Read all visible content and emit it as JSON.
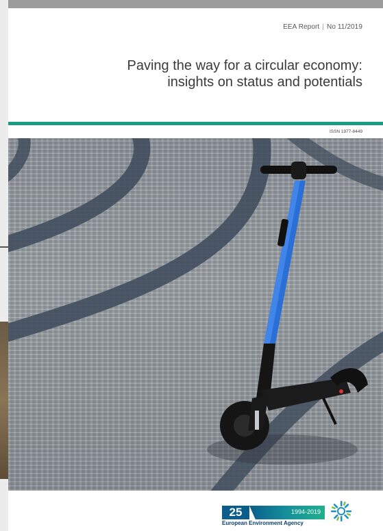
{
  "report": {
    "series": "EEA Report",
    "number": "No 11/2019",
    "title_line1": "Paving the way for a circular economy:",
    "title_line2": "insights on status and potentials",
    "issn": "ISSN 1977-8449"
  },
  "footer": {
    "logo_number": "25",
    "logo_years": "1994-2019",
    "agency_name": "European Environment Agency"
  },
  "colors": {
    "accent_green": "#1b9a84",
    "scooter_blue": "#2a6fd6",
    "eea_blue": "#0b5d8c"
  }
}
